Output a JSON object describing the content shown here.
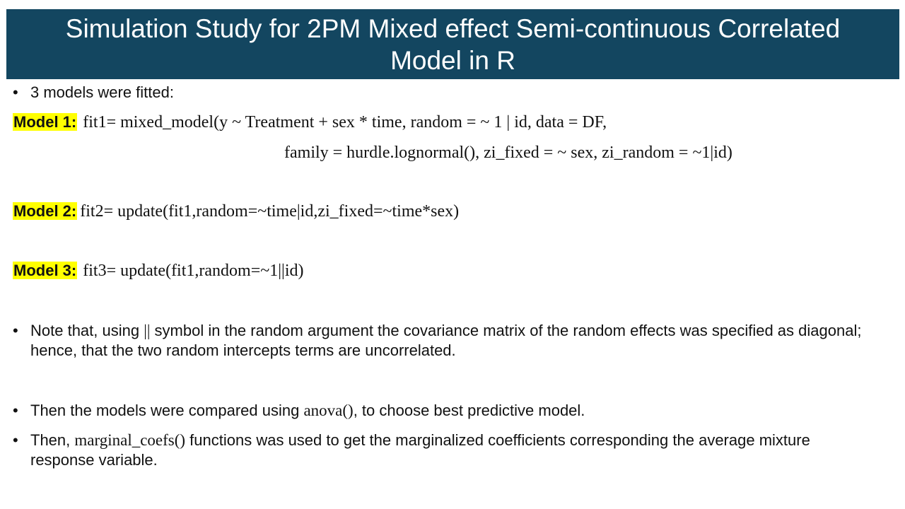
{
  "title": "Simulation Study for 2PM Mixed effect Semi-continuous Correlated Model in R",
  "bullets": {
    "b1": "3 models were fitted:",
    "note_prefix": "Note that, using ",
    "note_symbol": "||",
    "note_suffix": " symbol in the random argument the covariance matrix of the random effects was specified as diagonal; hence, that the two random intercepts terms are uncorrelated.",
    "compare_prefix": "Then the models  were compared using ",
    "compare_fn": "anova()",
    "compare_suffix": ", to choose best predictive model.",
    "marginal_prefix": "Then, ",
    "marginal_fn": "marginal_coefs()",
    "marginal_suffix": " functions was used to get the marginalized coefficients corresponding the average mixture response variable."
  },
  "models": {
    "m1_label": "Model 1:",
    "m1_code_line1": "fit1= mixed_model(y ~ Treatment + sex * time, random = ~ 1 | id,  data = DF,",
    "m1_code_line2": "family = hurdle.lognormal(), zi_fixed = ~ sex, zi_random = ~1|id)",
    "m2_label": "Model 2:",
    "m2_code": "fit2= update(fit1,random=~time|id,zi_fixed=~time*sex)",
    "m3_label": "Model 3:",
    "m3_code": "fit3= update(fit1,random=~1||id)"
  },
  "colors": {
    "title_bg": "#134660",
    "highlight": "#ffff00"
  }
}
